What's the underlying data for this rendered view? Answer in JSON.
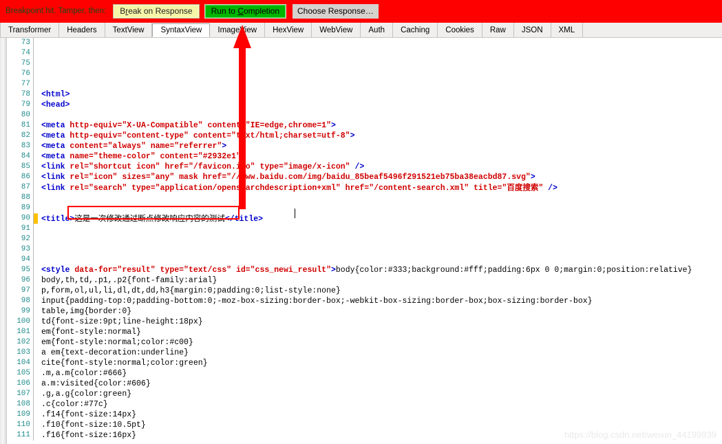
{
  "breakpoint_bar": {
    "label": "Breakpoint hit. Tamper, then:",
    "break_on_response": "Break on Response",
    "break_on_response_pre": "B",
    "break_on_response_accel": "r",
    "break_on_response_post": "eak on Response",
    "run_to_completion_pre": "Run to ",
    "run_to_completion_accel": "C",
    "run_to_completion_post": "ompletion",
    "choose_response": "Choose Response…",
    "bar_color": "#ff0000",
    "run_button_color": "#00b400",
    "break_button_color": "#f5f5a8"
  },
  "tabs": [
    {
      "label": "Transformer",
      "active": false
    },
    {
      "label": "Headers",
      "active": false
    },
    {
      "label": "TextView",
      "active": false
    },
    {
      "label": "SyntaxView",
      "active": true
    },
    {
      "label": "ImageView",
      "active": false
    },
    {
      "label": "HexView",
      "active": false
    },
    {
      "label": "WebView",
      "active": false
    },
    {
      "label": "Auth",
      "active": false
    },
    {
      "label": "Caching",
      "active": false
    },
    {
      "label": "Cookies",
      "active": false
    },
    {
      "label": "Raw",
      "active": false
    },
    {
      "label": "JSON",
      "active": false
    },
    {
      "label": "XML",
      "active": false
    }
  ],
  "code": {
    "lines": [
      {
        "num": "73",
        "breakpoint": false,
        "segments": []
      },
      {
        "num": "74",
        "breakpoint": false,
        "segments": []
      },
      {
        "num": "75",
        "breakpoint": false,
        "segments": []
      },
      {
        "num": "76",
        "breakpoint": false,
        "segments": []
      },
      {
        "num": "77",
        "breakpoint": false,
        "segments": []
      },
      {
        "num": "78",
        "breakpoint": false,
        "segments": [
          {
            "t": "tag",
            "v": "<html>"
          }
        ]
      },
      {
        "num": "79",
        "breakpoint": false,
        "segments": [
          {
            "t": "plain",
            "v": "    "
          },
          {
            "t": "tag",
            "v": "<head>"
          }
        ]
      },
      {
        "num": "80",
        "breakpoint": false,
        "segments": []
      },
      {
        "num": "81",
        "breakpoint": false,
        "segments": [
          {
            "t": "plain",
            "v": "        "
          },
          {
            "t": "tag",
            "v": "<meta "
          },
          {
            "t": "attr",
            "v": "http-equiv=\"X-UA-Compatible\" content=\"IE=edge,chrome=1\""
          },
          {
            "t": "tag",
            "v": ">"
          }
        ]
      },
      {
        "num": "82",
        "breakpoint": false,
        "segments": [
          {
            "t": "plain",
            "v": "        "
          },
          {
            "t": "tag",
            "v": "<meta "
          },
          {
            "t": "attr",
            "v": "http-equiv=\"content-type\" content=\"text/html;charset=utf-8\""
          },
          {
            "t": "tag",
            "v": ">"
          }
        ]
      },
      {
        "num": "83",
        "breakpoint": false,
        "segments": [
          {
            "t": "plain",
            "v": "        "
          },
          {
            "t": "tag",
            "v": "<meta "
          },
          {
            "t": "attr",
            "v": "content=\"always\" name=\"referrer\""
          },
          {
            "t": "tag",
            "v": ">"
          }
        ]
      },
      {
        "num": "84",
        "breakpoint": false,
        "segments": [
          {
            "t": "plain",
            "v": "        "
          },
          {
            "t": "tag",
            "v": "<meta "
          },
          {
            "t": "attr",
            "v": "name=\"theme-color\" content=\"#2932e1\""
          },
          {
            "t": "tag",
            "v": ">"
          }
        ]
      },
      {
        "num": "85",
        "breakpoint": false,
        "segments": [
          {
            "t": "plain",
            "v": "        "
          },
          {
            "t": "tag",
            "v": "<link "
          },
          {
            "t": "attr",
            "v": "rel=\"shortcut icon\" href=\"/favicon.ico\" type=\"image/x-icon\""
          },
          {
            "t": "tag",
            "v": " />"
          }
        ]
      },
      {
        "num": "86",
        "breakpoint": false,
        "segments": [
          {
            "t": "plain",
            "v": "        "
          },
          {
            "t": "tag",
            "v": "<link "
          },
          {
            "t": "attr",
            "v": "rel=\"icon\" sizes=\"any\" mask href=\"//www.baidu.com/img/baidu_85beaf5496f291521eb75ba38eacbd87.svg\""
          },
          {
            "t": "tag",
            "v": ">"
          }
        ]
      },
      {
        "num": "87",
        "breakpoint": false,
        "segments": [
          {
            "t": "plain",
            "v": "        "
          },
          {
            "t": "tag",
            "v": "<link "
          },
          {
            "t": "attr",
            "v": "rel=\"search\" type=\"application/opensearchdescription+xml\" href=\"/content-search.xml\" title=\""
          },
          {
            "t": "cjk",
            "v": "百度搜索"
          },
          {
            "t": "attr",
            "v": "\""
          },
          {
            "t": "tag",
            "v": " />"
          }
        ]
      },
      {
        "num": "88",
        "breakpoint": false,
        "segments": []
      },
      {
        "num": "89",
        "breakpoint": false,
        "segments": []
      },
      {
        "num": "90",
        "breakpoint": true,
        "segments": [
          {
            "t": "tag",
            "v": "<title>"
          },
          {
            "t": "cjk-black",
            "v": "这是一次修改通过断点修改响应内容的测试"
          },
          {
            "t": "tag",
            "v": "</title>"
          }
        ]
      },
      {
        "num": "91",
        "breakpoint": false,
        "segments": []
      },
      {
        "num": "92",
        "breakpoint": false,
        "segments": []
      },
      {
        "num": "93",
        "breakpoint": false,
        "segments": []
      },
      {
        "num": "94",
        "breakpoint": false,
        "segments": []
      },
      {
        "num": "95",
        "breakpoint": false,
        "segments": [
          {
            "t": "tag",
            "v": "<style "
          },
          {
            "t": "attr",
            "v": "data-for=\"result\" type=\"text/css\" id=\"css_newi_result\""
          },
          {
            "t": "tag",
            "v": ">"
          },
          {
            "t": "plain",
            "v": "body{color:#333;background:#fff;padding:6px 0 0;margin:0;position:relative}"
          }
        ]
      },
      {
        "num": "96",
        "breakpoint": false,
        "segments": [
          {
            "t": "plain",
            "v": "body,th,td,.p1,.p2{font-family:arial}"
          }
        ]
      },
      {
        "num": "97",
        "breakpoint": false,
        "segments": [
          {
            "t": "plain",
            "v": "p,form,ol,ul,li,dl,dt,dd,h3{margin:0;padding:0;list-style:none}"
          }
        ]
      },
      {
        "num": "98",
        "breakpoint": false,
        "segments": [
          {
            "t": "plain",
            "v": "input{padding-top:0;padding-bottom:0;-moz-box-sizing:border-box;-webkit-box-sizing:border-box;box-sizing:border-box}"
          }
        ]
      },
      {
        "num": "99",
        "breakpoint": false,
        "segments": [
          {
            "t": "plain",
            "v": "table,img{border:0}"
          }
        ]
      },
      {
        "num": "100",
        "breakpoint": false,
        "segments": [
          {
            "t": "plain",
            "v": "td{font-size:9pt;line-height:18px}"
          }
        ]
      },
      {
        "num": "101",
        "breakpoint": false,
        "segments": [
          {
            "t": "plain",
            "v": "em{font-style:normal}"
          }
        ]
      },
      {
        "num": "102",
        "breakpoint": false,
        "segments": [
          {
            "t": "plain",
            "v": "em{font-style:normal;color:#c00}"
          }
        ]
      },
      {
        "num": "103",
        "breakpoint": false,
        "segments": [
          {
            "t": "plain",
            "v": "a em{text-decoration:underline}"
          }
        ]
      },
      {
        "num": "104",
        "breakpoint": false,
        "segments": [
          {
            "t": "plain",
            "v": "cite{font-style:normal;color:green}"
          }
        ]
      },
      {
        "num": "105",
        "breakpoint": false,
        "segments": [
          {
            "t": "plain",
            "v": ".m,a.m{color:#666}"
          }
        ]
      },
      {
        "num": "106",
        "breakpoint": false,
        "segments": [
          {
            "t": "plain",
            "v": "a.m:visited{color:#606}"
          }
        ]
      },
      {
        "num": "107",
        "breakpoint": false,
        "segments": [
          {
            "t": "plain",
            "v": ".g,a.g{color:green}"
          }
        ]
      },
      {
        "num": "108",
        "breakpoint": false,
        "segments": [
          {
            "t": "plain",
            "v": ".c{color:#77c}"
          }
        ]
      },
      {
        "num": "109",
        "breakpoint": false,
        "segments": [
          {
            "t": "plain",
            "v": ".f14{font-size:14px}"
          }
        ]
      },
      {
        "num": "110",
        "breakpoint": false,
        "segments": [
          {
            "t": "plain",
            "v": ".f10{font-size:10.5pt}"
          }
        ]
      },
      {
        "num": "111",
        "breakpoint": false,
        "segments": [
          {
            "t": "plain",
            "v": ".f16{font-size:16px}"
          }
        ]
      }
    ]
  },
  "annotations": {
    "arrow_color": "#ff0000",
    "highlight_box_color": "#ff0000"
  },
  "watermark": {
    "text": "https://blog.csdn.net/weixin_44199939"
  }
}
